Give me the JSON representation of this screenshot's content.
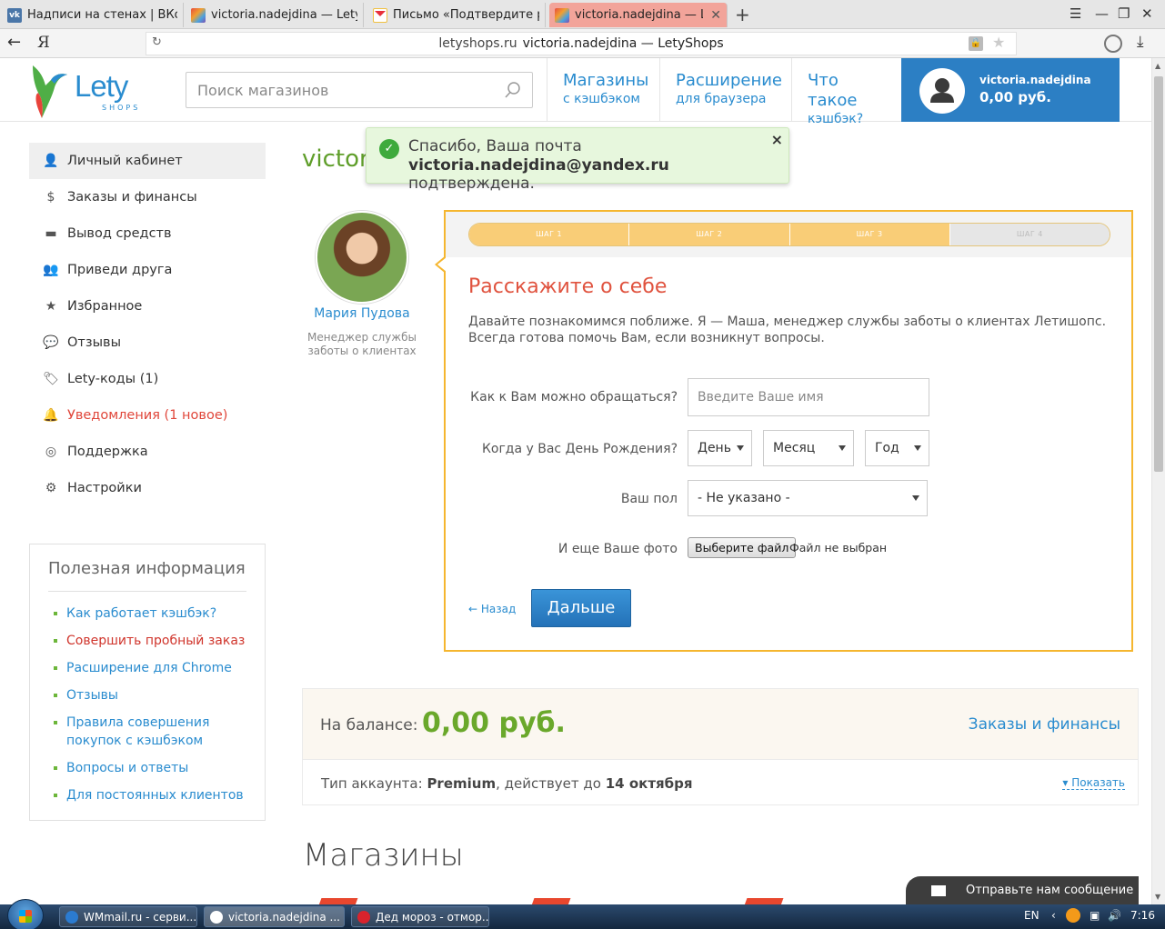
{
  "browser": {
    "tabs": [
      {
        "title": "Надписи на стенах | ВКонта",
        "icon": "vk-icon"
      },
      {
        "title": "victoria.nadejdina — LetySho",
        "icon": "letyshops-icon"
      },
      {
        "title": "Письмо «Подтвердите реги",
        "icon": "yandex-mail-icon"
      },
      {
        "title": "victoria.nadejdina — Lety",
        "icon": "letyshops-icon",
        "active": true
      }
    ],
    "new_tab": "+",
    "nav_logo": "Я",
    "address": {
      "domain": "letyshops.ru",
      "page_title": "victoria.nadejdina — LetyShops"
    }
  },
  "site": {
    "logo_text": "Lety",
    "logo_sub": "SHOPS",
    "search_placeholder": "Поиск магазинов",
    "nav": [
      {
        "line1": "Магазины",
        "line2": "с кэшбэком"
      },
      {
        "line1": "Расширение",
        "line2": "для браузера"
      },
      {
        "line1": "Что такое",
        "line2": "кэшбэк?"
      }
    ],
    "user": {
      "name": "victoria.nadejdina",
      "balance": "0,00 руб."
    }
  },
  "sidebar": {
    "items": [
      {
        "label": "Личный кабинет",
        "icon": "user-icon"
      },
      {
        "label": "Заказы и финансы",
        "icon": "dollar-icon"
      },
      {
        "label": "Вывод средств",
        "icon": "wallet-icon"
      },
      {
        "label": "Приведи друга",
        "icon": "add-user-icon"
      },
      {
        "label": "Избранное",
        "icon": "star-icon"
      },
      {
        "label": "Отзывы",
        "icon": "comments-icon"
      },
      {
        "label": "Lety-коды (1)",
        "icon": "tags-icon"
      },
      {
        "label": "Уведомления (1 новое)",
        "icon": "bell-icon"
      },
      {
        "label": "Поддержка",
        "icon": "lifebuoy-icon"
      },
      {
        "label": "Настройки",
        "icon": "gear-icon"
      }
    ]
  },
  "useful": {
    "title": "Полезная информация",
    "links": [
      "Как работает кэшбэк?",
      "Совершить пробный заказ",
      "Расширение для Chrome",
      "Отзывы",
      "Правила совершения покупок с кэшбэком",
      "Вопросы и ответы",
      "Для постоянных клиентов"
    ]
  },
  "main": {
    "title": "victor",
    "toast": {
      "line1": "Спасибо, Ваша почта",
      "email": "victoria.nadejdina@yandex.ru",
      "line2_suffix": " подтверждена.",
      "close": "×"
    },
    "manager": {
      "name": "Мария Пудова",
      "role": "Менеджер службы заботы о клиентах"
    },
    "wizard": {
      "steps": [
        "ШАГ 1",
        "ШАГ 2",
        "ШАГ 3",
        "ШАГ 4"
      ],
      "steps_done": 3,
      "title": "Расскажите о себе",
      "intro": "Давайте познакомимся поближе. Я — Маша, менеджер службы заботы о клиентах Летишопс. Всегда готова помочь Вам, если возникнут вопросы.",
      "name_label": "Как к Вам можно обращаться?",
      "name_placeholder": "Введите Ваше имя",
      "birthday_label": "Когда у Вас День Рождения?",
      "day": "День",
      "month": "Месяц",
      "year": "Год",
      "gender_label": "Ваш пол",
      "gender_value": "- Не указано -",
      "photo_label": "И еще Ваше фото",
      "file_button": "Выберите файл",
      "file_none": "Файл не выбран",
      "back": "← Назад",
      "next": "Дальше"
    },
    "balance": {
      "label": "На балансе:",
      "value": "0,00 руб.",
      "link": "Заказы и финансы",
      "account_prefix": "Тип аккаунта: ",
      "account_type": "Premium",
      "account_mid": ", действует до ",
      "account_until": "14 октября",
      "show": "▾ Показать"
    },
    "shops_title": "Магазины"
  },
  "widget": {
    "message": "Отправьте нам сообщение"
  },
  "taskbar": {
    "tasks": [
      "WMmail.ru - серви...",
      "victoria.nadejdina ...",
      "Дед мороз - отмор..."
    ],
    "lang": "EN",
    "time": "7:16"
  },
  "colors": {
    "brand_blue": "#2a8ccf",
    "green": "#6aa82b",
    "orange_border": "#f5b62f",
    "alert_red": "#e0463a"
  }
}
